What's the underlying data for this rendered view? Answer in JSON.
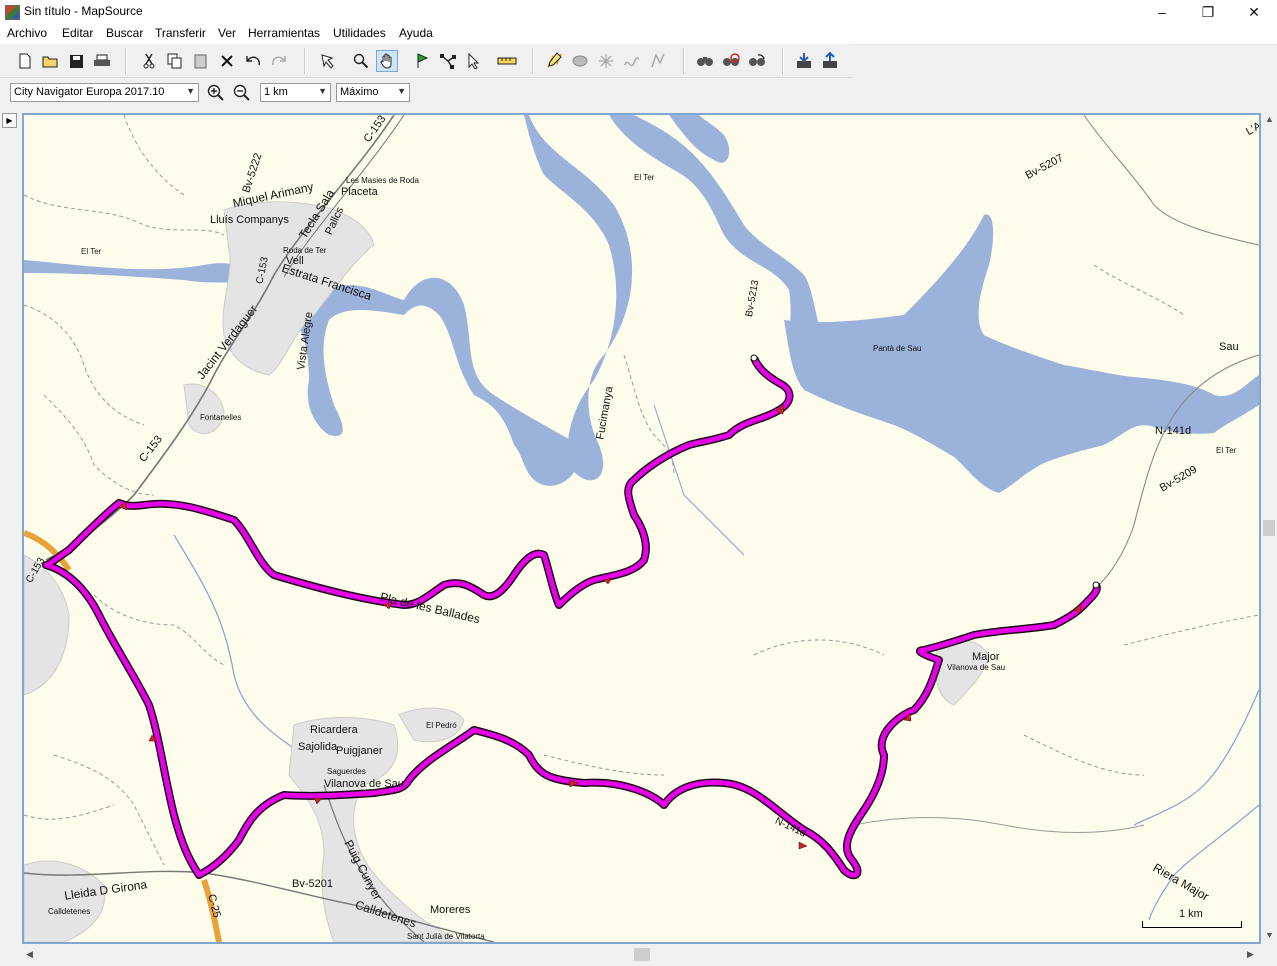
{
  "window": {
    "title": "Sin título - MapSource"
  },
  "menu": [
    "Archivo",
    "Editar",
    "Buscar",
    "Transferir",
    "Ver",
    "Herramientas",
    "Utilidades",
    "Ayuda"
  ],
  "toolbar2": {
    "map_product": "City Navigator Europa 2017.10",
    "scale": "1 km",
    "detail": "Máximo"
  },
  "map": {
    "scale_label": "1 km",
    "labels": {
      "bv5222": "Bv-5222",
      "c153_top": "C-153",
      "miquel": "Miquel Arimany",
      "teclasala": "Tecla Sala",
      "placeta": "Placeta",
      "masies": "Les Masies de Roda",
      "lluis": "Lluís Companys",
      "palics": "Pallcs",
      "elter1": "El Ter",
      "rodater": "Roda de Ter",
      "c153_mid": "C-153",
      "estrata": "Estrata Francisca",
      "vell": "Vell",
      "vistaalegre": "Vista Alegre",
      "jacint": "Jacint Verdaguer",
      "fontanelles": "Fontanelles",
      "c153_low": "C-153",
      "c153_left": "C-153",
      "elter2": "El Ter",
      "bv5207": "Bv-5207",
      "bv5213": "Bv-5213",
      "pantasau": "Pantà de Sau",
      "sau": "Sau",
      "fucimanya": "Fucimanya",
      "n141d": "N-141d",
      "elter3": "El Ter",
      "bv5209": "Bv-5209",
      "pladeles": "Pla de les Ballades",
      "major": "Major",
      "vilanova_small": "Vilanova de Sau",
      "ricardera": "Ricardera",
      "sajolida": "Sajolida",
      "puigjaner": "Puigjaner",
      "elpedro": "El Pedró",
      "saguerdes": "Saguerdes",
      "vilanova": "Vilanova de Sau",
      "n141d_low": "N-141d",
      "lleida": "Lleida D Girona",
      "bv5201": "Bv-5201",
      "c25": "C-25",
      "puigcunyer": "Puig Cunyer",
      "calldetenes": "Calldetenes",
      "moreres": "Moreres",
      "santjulia": "Sant Julià de Vilatorta",
      "calldetenes_small": "Calldetenes",
      "riera": "Riera Major",
      "la": "L'A"
    }
  },
  "colors": {
    "map_bg": "#fefdeb",
    "water": "#9bb3db",
    "track": "#e600e6",
    "track_outline": "#1a0a1a",
    "highway": "#e8a23a",
    "frame": "#7fa7cf"
  },
  "icons": [
    "new-icon",
    "open-icon",
    "save-icon",
    "print-icon",
    "cut-icon",
    "copy-icon",
    "paste-icon",
    "delete-icon",
    "undo-icon",
    "redo-icon",
    "map-select-icon",
    "zoom-tool-icon",
    "hand-icon",
    "waypoint-icon",
    "route-icon",
    "select-icon",
    "measure-icon",
    "track-icon",
    "find-icon",
    "find-address-icon",
    "find-nearest-icon",
    "receive-icon",
    "send-icon"
  ]
}
